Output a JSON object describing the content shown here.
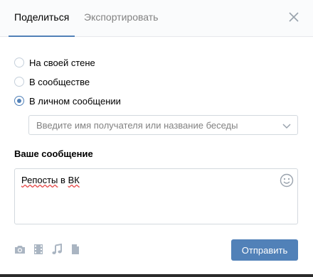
{
  "tabs": [
    {
      "label": "Поделиться",
      "active": true
    },
    {
      "label": "Экспортировать",
      "active": false
    }
  ],
  "share_options": [
    {
      "label": "На своей стене",
      "checked": false
    },
    {
      "label": "В сообществе",
      "checked": false
    },
    {
      "label": "В личном сообщении",
      "checked": true
    }
  ],
  "recipient": {
    "placeholder": "Введите имя получателя или название беседы"
  },
  "message": {
    "title": "Ваше сообщение",
    "word1": "Репосты",
    "word2": "в",
    "word3": "ВК"
  },
  "attachments": [
    "camera-icon",
    "video-icon",
    "music-icon",
    "document-icon"
  ],
  "send_button": {
    "label": "Отправить"
  },
  "colors": {
    "accent": "#5181b8",
    "border": "#d3d9de",
    "muted": "#828282",
    "icon": "#aab5c2"
  }
}
